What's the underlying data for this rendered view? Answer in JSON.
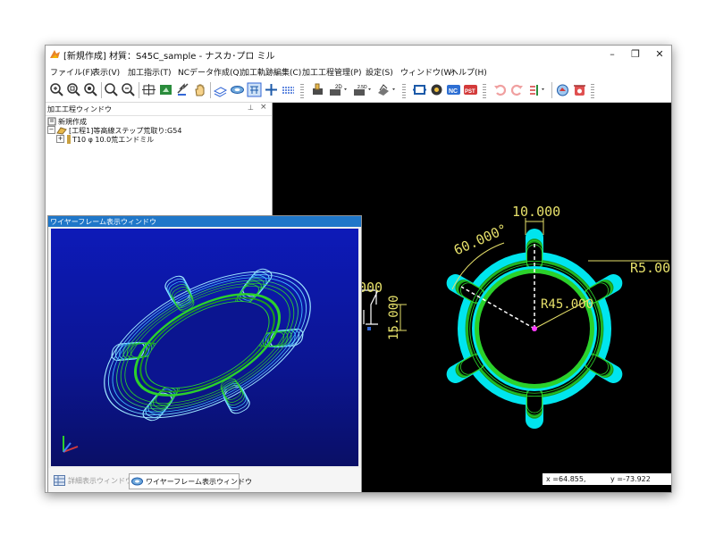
{
  "window": {
    "title": "[新規作成] 材質：S45C_sample - ナスカ･プロ ミル",
    "minimize": "–",
    "maximize": "❐",
    "close": "✕"
  },
  "menu": [
    "ファイル(F)",
    "表示(V)",
    "加工指示(T)",
    "NCデータ作成(Q)",
    "加工軌跡編集(C)",
    "加工工程管理(P)",
    "設定(S)",
    "ウィンドウ(W)",
    "ヘルプ(H)"
  ],
  "toolbar": {
    "icons": [
      "zoom-in-icon",
      "zoom-window-icon",
      "zoom-extents-icon",
      "zoom-out-icon",
      "zoom-realtime-icon",
      "center-view-icon",
      "fit-view-icon",
      "pan-arrow-icon",
      "pan-hand-icon",
      "layer-sheet-icon",
      "solid-view-icon",
      "toggle-grid-icon",
      "add-point-icon",
      "dimension-icon",
      "stock-icon",
      "2d-shape-icon",
      "2-5d-shape-icon",
      "3d-shape-icon",
      "tool-frame-icon",
      "tool-setting-icon",
      "nc-output-icon",
      "post-processor-icon",
      "undo-icon",
      "redo-icon",
      "layer-order-icon",
      "simulation-icon",
      "delete-icon"
    ],
    "labels": {
      "two_d": "2D",
      "two_five_d": "2.5D",
      "nc": "NC",
      "pst": "PST"
    }
  },
  "tree_pane": {
    "title": "加工工程ウィンドウ",
    "pin": "⊥",
    "close": "×",
    "root": "新規作成",
    "process": "[工程1]等高線ステップ荒取り:G54",
    "tool": "T10 φ 10.0荒エンドミル"
  },
  "viewport": {
    "dim_width": "10.000",
    "dim_angle": "60.000°",
    "dim_radius_small": "R5.00",
    "dim_radius_main": "R45.000",
    "dim_left": "000",
    "dim_height": "15.000",
    "colors": {
      "contour": "#00e5ee",
      "toolpath": "#2bd12b",
      "dimension": "#e6e06a",
      "background": "#000000"
    }
  },
  "status": {
    "x": "x =64.855,",
    "y": "y =-73.922"
  },
  "wireframe": {
    "title": "ワイヤーフレーム表示ウィンドウ",
    "tab_detail": "詳細表示ウィンドウ",
    "tab_wire": "ワイヤーフレーム表示ウィンドウ"
  }
}
